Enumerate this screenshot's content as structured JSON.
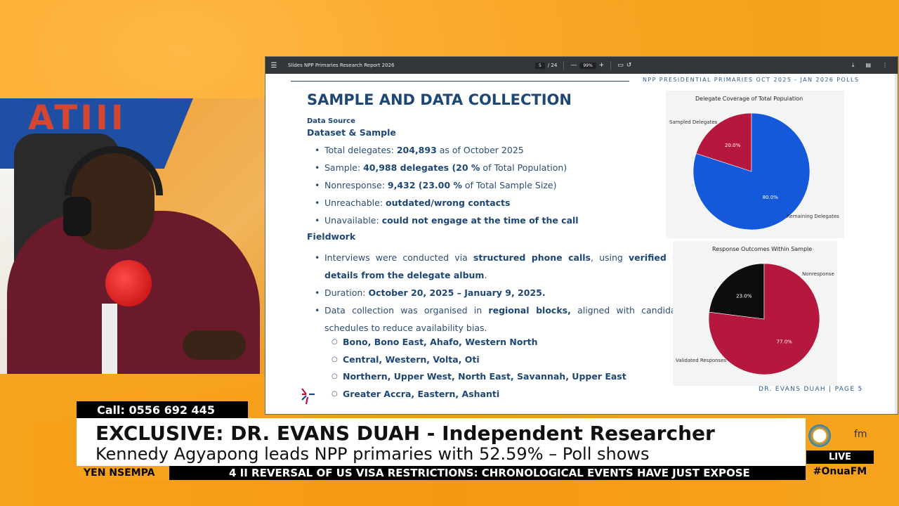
{
  "viewer": {
    "doc_title": "Slides NPP Primaries Research Report 2026",
    "page_current": "5",
    "page_total": "/ 24",
    "zoom_minus": "—",
    "zoom": "99%",
    "zoom_plus": "+"
  },
  "slide": {
    "header": "NPP PRESIDENTIAL PRIMARIES OCT 2025 - JAN 2026 POLLS",
    "title": "SAMPLE AND DATA COLLECTION",
    "data_source": "Data Source",
    "section1": "Dataset & Sample",
    "bullets1": [
      {
        "pre": "Total delegates: ",
        "bold": "204,893",
        "post": " as of October 2025"
      },
      {
        "pre": "Sample: ",
        "bold": "40,988 delegates (20 %",
        "post": " of Total Population)"
      },
      {
        "pre": "Nonresponse: ",
        "bold": "9,432 (23.00 %",
        "post": " of Total Sample Size)"
      },
      {
        "pre": "Unreachable: ",
        "bold": "outdated/wrong contacts",
        "post": ""
      },
      {
        "pre": "Unavailable: ",
        "bold": "could not engage at the time of the call",
        "post": ""
      }
    ],
    "section2": "Fieldwork",
    "fw1_pre": "Interviews were conducted via ",
    "fw1_b1": "structured phone calls",
    "fw1_mid": ", using ",
    "fw1_b2": "verified contact",
    "fw1_b3": "details from the delegate album",
    "fw1_end": ".",
    "fw2_pre": "Duration: ",
    "fw2_bold": "October 20, 2025 – January 9, 2025.",
    "fw3_pre": "Data collection was organised in ",
    "fw3_bold": "regional blocks,",
    "fw3_post": " aligned with candidate tour",
    "fw3_line2": "schedules to reduce availability bias.",
    "regions": [
      "Bono, Bono East, Ahafo, Western North",
      "Central, Western, Volta, Oti",
      "Northern, Upper West, North East, Savannah, Upper East",
      "Greater Accra, Eastern, Ashanti"
    ],
    "footer": "DR. EVANS DUAH | PAGE 5"
  },
  "chart_data": [
    {
      "type": "pie",
      "title": "Delegate Coverage of Total Population",
      "categories": [
        "Sampled Delegates",
        "Remaining Delegates"
      ],
      "values": [
        20.0,
        80.0
      ],
      "value_labels": [
        "20.0%",
        "80.0%"
      ],
      "colors": [
        "#b5173d",
        "#1459d9"
      ]
    },
    {
      "type": "pie",
      "title": "Response Outcomes Within Sample",
      "categories": [
        "Nonresponse",
        "Validated Responses"
      ],
      "values": [
        23.0,
        77.0
      ],
      "value_labels": [
        "23.0%",
        "77.0%"
      ],
      "colors": [
        "#0d0d0d",
        "#b5173d"
      ]
    }
  ],
  "broadcast": {
    "phone": "Call:  0556 692 445",
    "headline": "EXCLUSIVE: DR. EVANS DUAH - Independent Researcher",
    "subhead": "Kennedy Agyapong leads NPP primaries with 52.59% – Poll shows",
    "ticker_tag": "YEN NSEMPA",
    "ticker": "4 II REVERSAL OF US VISA RESTRICTIONS: CHRONOLOGICAL EVENTS HAVE JUST EXPOSE",
    "live": "LIVE",
    "hashtag": "#OnuaFM",
    "brand": "fm"
  },
  "studio": {
    "wall_text": "ATIII"
  },
  "colors": {
    "accent_orange": "#f7a21c",
    "navy": "#1d4777",
    "pie_red": "#b5173d",
    "pie_blue": "#1459d9"
  }
}
